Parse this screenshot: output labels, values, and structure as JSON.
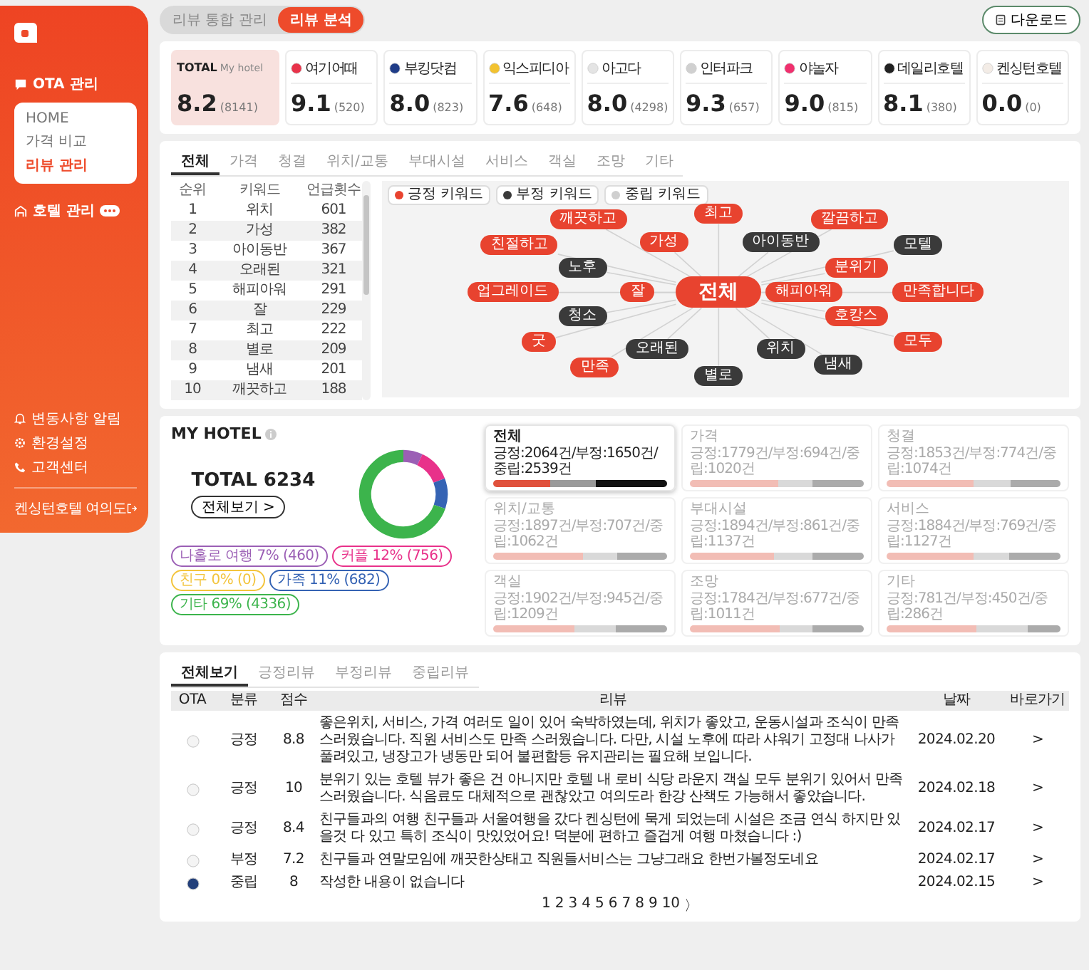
{
  "sidebar": {
    "nav": [
      {
        "label": "OTA 관리",
        "kind": "chat",
        "children": [
          {
            "label": "HOME",
            "selected": false
          },
          {
            "label": "가격 비교",
            "selected": false
          },
          {
            "label": "리뷰 관리",
            "selected": true
          }
        ]
      },
      {
        "label": "호텔 관리",
        "kind": "building",
        "badge": true
      }
    ],
    "footer_links": [
      {
        "label": "변동사항 알림",
        "kind": "bell"
      },
      {
        "label": "환경설정",
        "kind": "gear"
      },
      {
        "label": "고객센터",
        "kind": "phone"
      }
    ],
    "hotel_name": "켄싱턴호텔 여의도"
  },
  "view_toggle": [
    {
      "label": "리뷰 통합 관리",
      "selected": false
    },
    {
      "label": "리뷰 분석",
      "selected": true
    }
  ],
  "download_button": "다운로드",
  "score_cards": [
    {
      "kind": "total",
      "name": "TOTAL",
      "subtitle": "My hotel",
      "score": "8.2",
      "count": "(8141)"
    },
    {
      "kind": "ota",
      "name": "여기어때",
      "score": "9.1",
      "count": "(520)",
      "color": "#e8334a"
    },
    {
      "kind": "ota",
      "name": "부킹닷컴",
      "score": "8.0",
      "count": "(823)",
      "color": "#1f3c88"
    },
    {
      "kind": "ota",
      "name": "익스피디아",
      "score": "7.6",
      "count": "(648)",
      "color": "#f2c230"
    },
    {
      "kind": "ota",
      "name": "아고다",
      "score": "8.0",
      "count": "(4298)",
      "color": "#e4e4e4"
    },
    {
      "kind": "ota",
      "name": "인터파크",
      "score": "9.3",
      "count": "(657)",
      "color": "#d0d0d0"
    },
    {
      "kind": "ota",
      "name": "야놀자",
      "score": "9.0",
      "count": "(815)",
      "color": "#f0306e"
    },
    {
      "kind": "ota",
      "name": "데일리호텔",
      "score": "8.1",
      "count": "(380)",
      "color": "#222222"
    },
    {
      "kind": "ota",
      "name": "켄싱턴호텔",
      "score": "0.0",
      "count": "(0)",
      "color": "#f3ece6"
    }
  ],
  "keyword_tabs": [
    {
      "label": "전체",
      "selected": true
    },
    {
      "label": "가격",
      "selected": false
    },
    {
      "label": "청결",
      "selected": false
    },
    {
      "label": "위치/교통",
      "selected": false
    },
    {
      "label": "부대시설",
      "selected": false
    },
    {
      "label": "서비스",
      "selected": false
    },
    {
      "label": "객실",
      "selected": false
    },
    {
      "label": "조망",
      "selected": false
    },
    {
      "label": "기타",
      "selected": false
    }
  ],
  "keyword_table": {
    "columns": [
      "순위",
      "키워드",
      "언급횟수"
    ],
    "rows": [
      [
        "1",
        "위치",
        "601"
      ],
      [
        "2",
        "가성",
        "382"
      ],
      [
        "3",
        "아이동반",
        "367"
      ],
      [
        "4",
        "오래된",
        "321"
      ],
      [
        "5",
        "해피아워",
        "291"
      ],
      [
        "6",
        "잘",
        "229"
      ],
      [
        "7",
        "최고",
        "222"
      ],
      [
        "8",
        "별로",
        "209"
      ],
      [
        "9",
        "냄새",
        "201"
      ],
      [
        "10",
        "깨끗하고",
        "188"
      ]
    ]
  },
  "mind_map": {
    "legend": [
      {
        "label": "긍정 키워드",
        "color": "#e8432f"
      },
      {
        "label": "부정 키워드",
        "color": "#3a3a3a"
      },
      {
        "label": "중립 키워드",
        "color": "#cfcfcf"
      }
    ],
    "center": "전체",
    "nodes": [
      {
        "label": "최고",
        "kind": "positive"
      },
      {
        "label": "깨끗하고",
        "kind": "positive"
      },
      {
        "label": "가성",
        "kind": "positive"
      },
      {
        "label": "아이동반",
        "kind": "negative"
      },
      {
        "label": "깔끔하고",
        "kind": "positive"
      },
      {
        "label": "친절하고",
        "kind": "positive"
      },
      {
        "label": "모텔",
        "kind": "negative"
      },
      {
        "label": "노후",
        "kind": "negative"
      },
      {
        "label": "분위기",
        "kind": "positive"
      },
      {
        "label": "업그레이드",
        "kind": "positive"
      },
      {
        "label": "잘",
        "kind": "positive"
      },
      {
        "label": "해피아워",
        "kind": "positive"
      },
      {
        "label": "만족합니다",
        "kind": "positive"
      },
      {
        "label": "청소",
        "kind": "negative"
      },
      {
        "label": "호캉스",
        "kind": "positive"
      },
      {
        "label": "굿",
        "kind": "positive"
      },
      {
        "label": "오래된",
        "kind": "negative"
      },
      {
        "label": "모두",
        "kind": "positive"
      },
      {
        "label": "만족",
        "kind": "positive"
      },
      {
        "label": "위치",
        "kind": "negative"
      },
      {
        "label": "냄새",
        "kind": "negative"
      },
      {
        "label": "별로",
        "kind": "negative"
      }
    ]
  },
  "my_hotel": {
    "title": "MY HOTEL",
    "total": "TOTAL 6234",
    "view_all": "전체보기 >",
    "chart_data": {
      "type": "donut",
      "categories": [
        "나홀로 여행",
        "커플",
        "친구",
        "가족",
        "기타"
      ],
      "values": [
        7,
        12,
        0,
        11,
        69
      ]
    },
    "legend": [
      {
        "percent": "7%",
        "count": "(460)",
        "color": "#9b5fb5"
      },
      {
        "percent": "12%",
        "count": "(756)",
        "color": "#e8318a"
      },
      {
        "percent": "0%",
        "count": "(0)",
        "color": "#f3c43c"
      },
      {
        "percent": "11%",
        "count": "(682)",
        "color": "#3563b4"
      },
      {
        "percent": "69%",
        "count": "(4336)",
        "color": "#3cb44c"
      }
    ],
    "categories": [
      {
        "name": "전체",
        "counts": "긍정:2064건/부정:1650건/중립:2539건",
        "selected": true
      },
      {
        "name": "가격",
        "counts": "긍정:1779건/부정:694건/중립:1020건",
        "selected": false
      },
      {
        "name": "청결",
        "counts": "긍정:1853건/부정:774건/중립:1074건",
        "selected": false
      },
      {
        "name": "위치/교통",
        "counts": "긍정:1897건/부정:707건/중립:1062건",
        "selected": false
      },
      {
        "name": "부대시설",
        "counts": "긍정:1894건/부정:861건/중립:1137건",
        "selected": false
      },
      {
        "name": "서비스",
        "counts": "긍정:1884건/부정:769건/중립:1127건",
        "selected": false
      },
      {
        "name": "객실",
        "counts": "긍정:1902건/부정:945건/중립:1209건",
        "selected": false
      },
      {
        "name": "조망",
        "counts": "긍정:1784건/부정:677건/중립:1011건",
        "selected": false
      },
      {
        "name": "기타",
        "counts": "긍정:781건/부정:450건/중립:286건",
        "selected": false
      }
    ]
  },
  "reviews": {
    "tabs": [
      {
        "label": "전체보기",
        "selected": true
      },
      {
        "label": "긍정리뷰",
        "selected": false
      },
      {
        "label": "부정리뷰",
        "selected": false
      },
      {
        "label": "중립리뷰",
        "selected": false
      }
    ],
    "columns": [
      "OTA",
      "분류",
      "점수",
      "리뷰",
      "날짜",
      "바로가기"
    ],
    "rows": [
      {
        "color": "#f4f4f4",
        "category": "긍정",
        "score": "8.8",
        "text": "좋은위치, 서비스, 가격 여러도 일이 있어 숙박하였는데, 위치가 좋았고, 운동시설과 조식이 만족스러웠습니다. 직원 서비스도 만족 스러웠습니다. 다만, 시설 노후에 따라 샤워기 고정대 나사가 풀려있고, 냉장고가 냉동만 되어 불편함등 유지관리는 필요해 보입니다.",
        "date": "2024.02.20",
        "link": ">"
      },
      {
        "color": "#f4f4f4",
        "category": "긍정",
        "score": "10",
        "text": "분위기 있는 호텔 뷰가 좋은 건 아니지만 호텔 내 로비 식당 라운지 객실 모두 분위기 있어서 만족스러웠습니다. 식음료도 대체적으로 괜찮았고 여의도라 한강 산책도 가능해서 좋았습니다.",
        "date": "2024.02.18",
        "link": ">"
      },
      {
        "color": "#f4f4f4",
        "category": "긍정",
        "score": "8.4",
        "text": "친구들과의 여행 친구들과 서울여행을 갔다 켄싱턴에 묵게 되었는데 시설은 조금 연식 하지만 있을것 다 있고 특히 조식이 맛있었어요! 덕분에 편하고 즐겁게 여행 마쳤습니다 :)",
        "date": "2024.02.17",
        "link": ">"
      },
      {
        "color": "#f4f4f4",
        "category": "부정",
        "score": "7.2",
        "text": "친구들과 연말모임에 깨끗한상태고 직원들서비스는 그냥그래요 한번가볼정도네요",
        "date": "2024.02.17",
        "link": ">"
      },
      {
        "color": "#23407a",
        "category": "중립",
        "score": "8",
        "text": "작성한 내용이 없습니다",
        "date": "2024.02.15",
        "link": ">"
      }
    ],
    "pages": [
      "1",
      "2",
      "3",
      "4",
      "5",
      "6",
      "7",
      "8",
      "9",
      "10"
    ],
    "next": "〉"
  }
}
